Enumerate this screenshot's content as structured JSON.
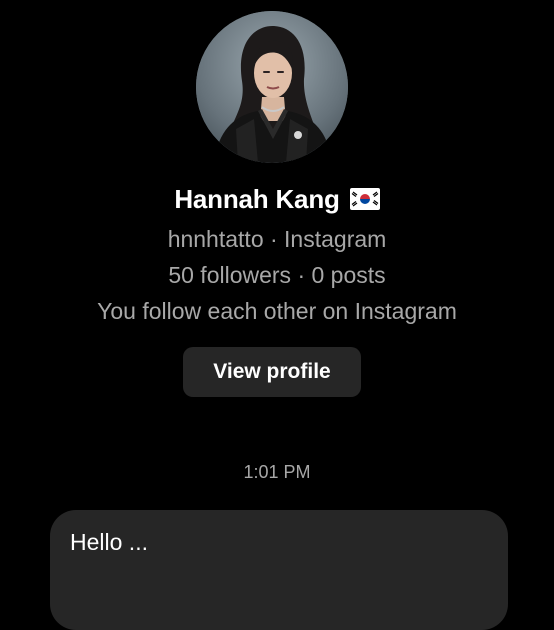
{
  "profile": {
    "avatar_icon": "avatar-photo",
    "name": "Hannah Kang",
    "flag_icon": "south-korea-flag-icon",
    "username_line": "hnnhtatto · Instagram",
    "stats_line": "50 followers · 0 posts",
    "relationship_line": "You follow each other on Instagram",
    "view_profile_label": "View profile"
  },
  "conversation": {
    "timestamp": "1:01 PM",
    "messages": [
      {
        "text": "Hello ...",
        "direction": "incoming"
      }
    ]
  },
  "colors": {
    "background": "#000000",
    "secondary_text": "#a8a8a8",
    "surface": "#262626",
    "primary_text": "#ffffff"
  }
}
